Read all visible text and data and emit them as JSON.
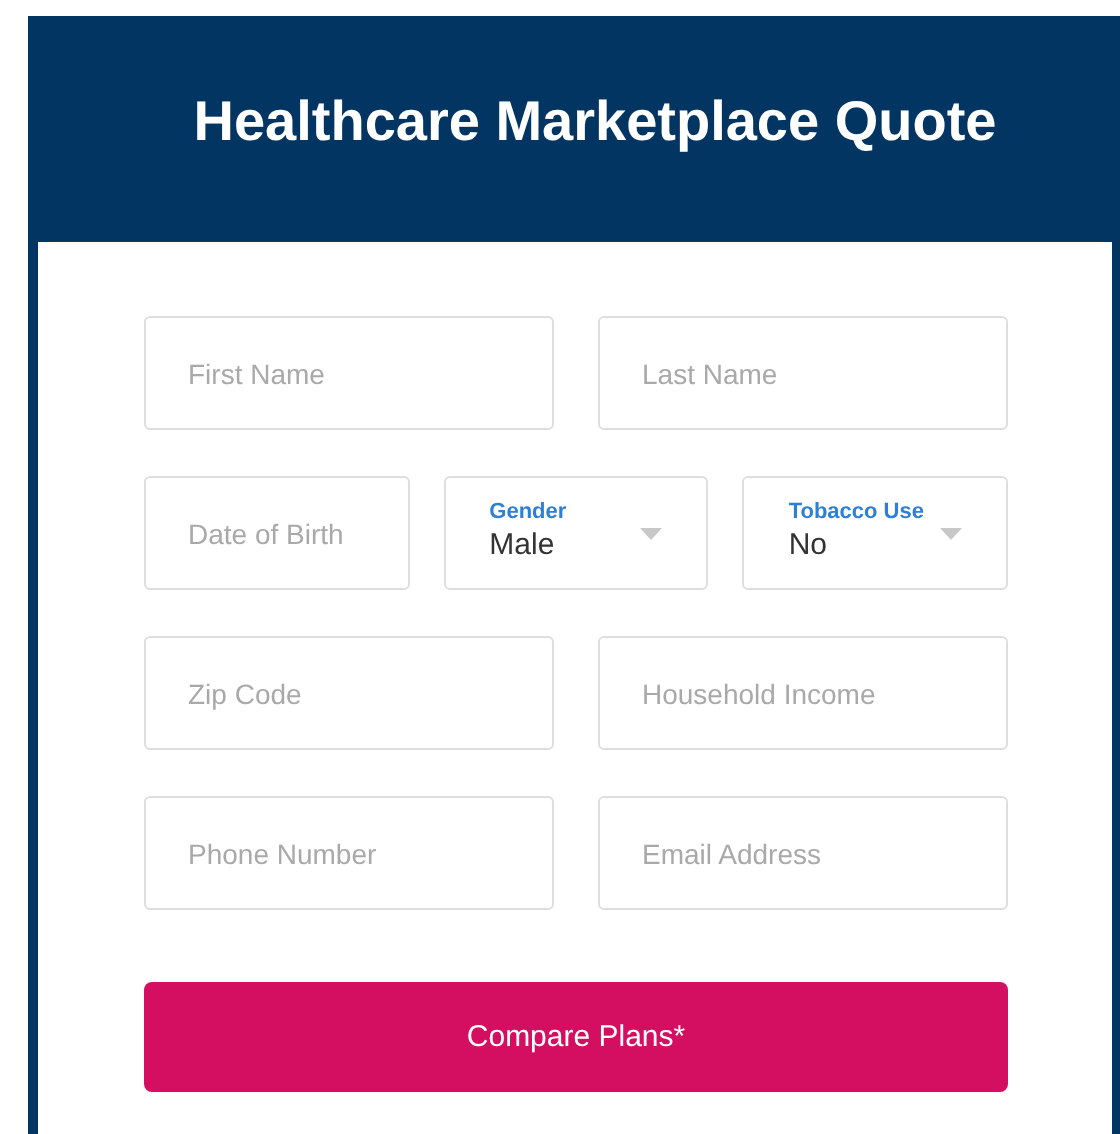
{
  "title": "Healthcare Marketplace Quote",
  "form_rows": [
    [
      {
        "kind": "text",
        "placeholder": "First Name"
      },
      {
        "kind": "text",
        "placeholder": "Last Name"
      }
    ],
    [
      {
        "kind": "text",
        "placeholder": "Date of Birth"
      },
      {
        "kind": "select",
        "label": "Gender",
        "value": "Male"
      },
      {
        "kind": "select",
        "label": "Tobacco Use",
        "value": "No"
      }
    ],
    [
      {
        "kind": "text",
        "placeholder": "Zip Code"
      },
      {
        "kind": "text",
        "placeholder": "Household Income"
      }
    ],
    [
      {
        "kind": "text",
        "placeholder": "Phone Number"
      },
      {
        "kind": "text",
        "placeholder": "Email Address"
      }
    ]
  ],
  "submit_button": "Compare Plans*"
}
